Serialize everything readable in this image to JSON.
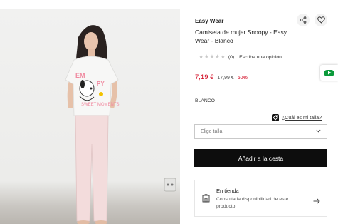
{
  "product": {
    "brand": "Easy Wear",
    "title": "Camiseta de mujer Snoopy - Easy Wear - Blanco",
    "rating_count": "(0)",
    "review_link": "Escribe una opinión",
    "price_now": "7,19 €",
    "price_old": "17,99 €",
    "discount": "60%",
    "color": "BLANCO"
  },
  "size": {
    "guide_link": "¿Cuál es mi talla?",
    "select_placeholder": "Elige talla"
  },
  "actions": {
    "add_to_cart": "Añadir a la cesta"
  },
  "store": {
    "title": "En tienda",
    "description": "Consulta la disponibilidad de este producto"
  },
  "icons": {
    "share": "share-icon",
    "favorite": "heart-icon",
    "tag": "tag-icon",
    "store": "store-icon",
    "arrow": "arrow-right-icon",
    "chevron": "chevron-down-icon"
  },
  "colors": {
    "price_red": "#d0021b",
    "button_black": "#0d0d0d",
    "promo_green": "#0a9a3a"
  }
}
